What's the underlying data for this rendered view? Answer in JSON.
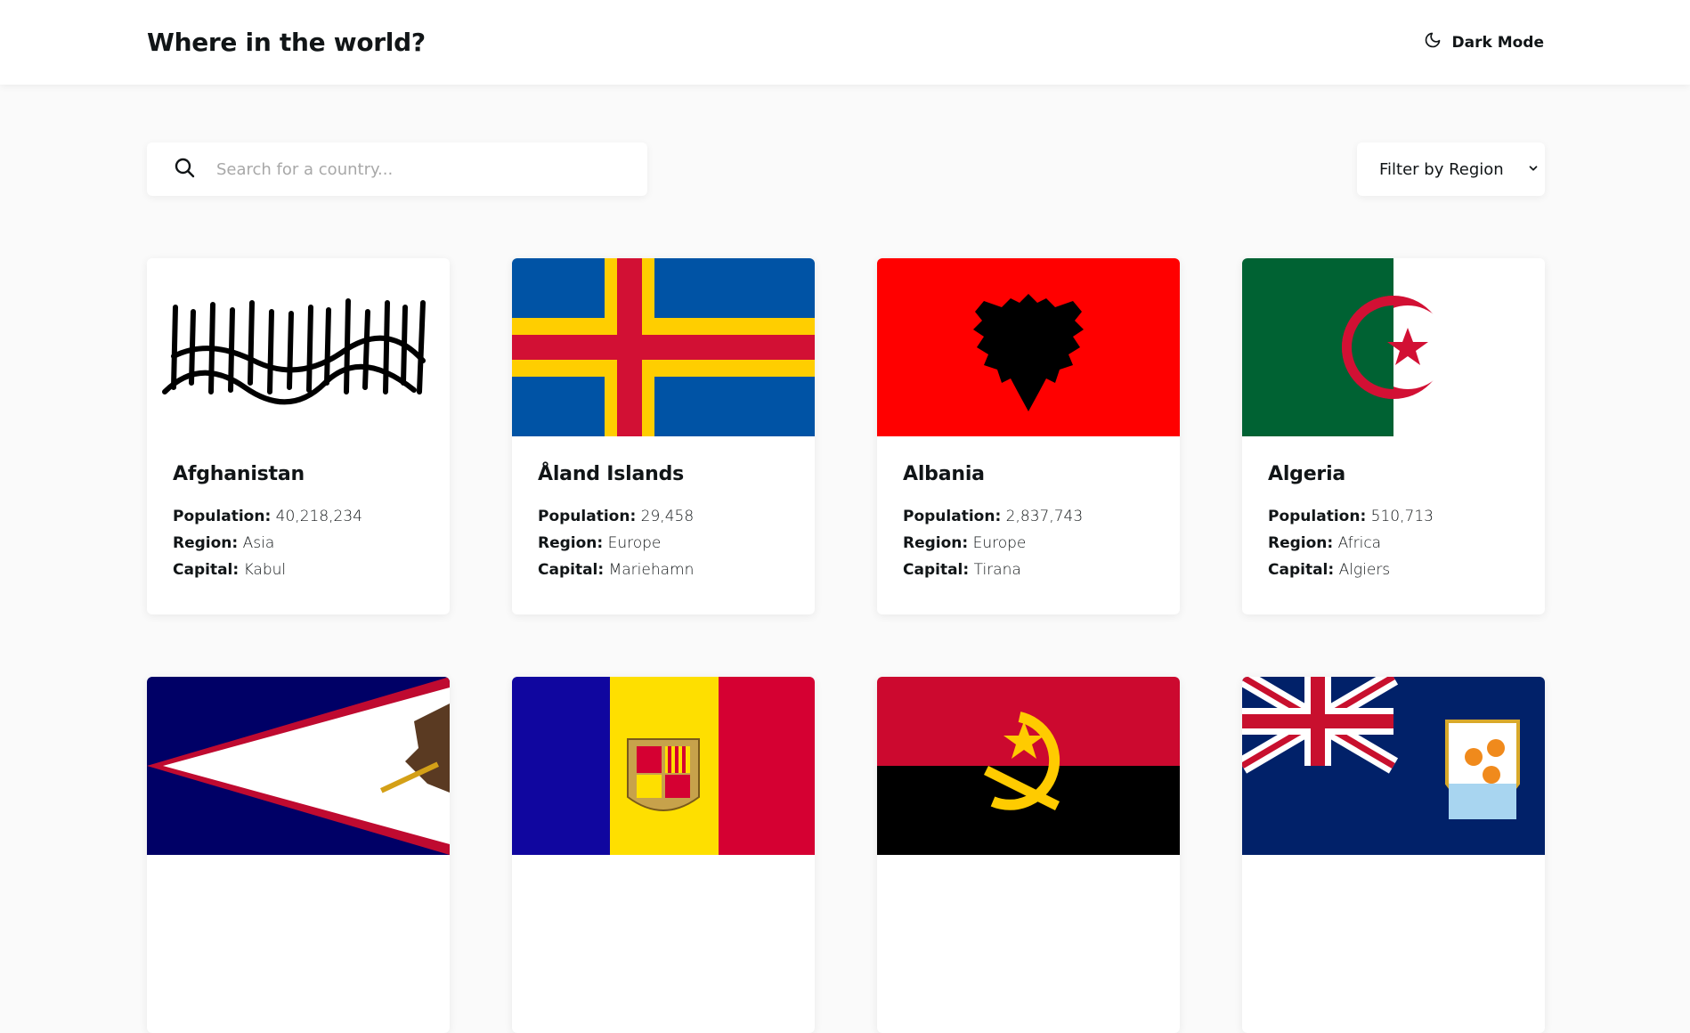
{
  "header": {
    "title": "Where in the world?",
    "mode_label": "Dark Mode"
  },
  "search": {
    "placeholder": "Search for a country..."
  },
  "filter": {
    "label": "Filter by Region"
  },
  "card_labels": {
    "population": "Population:",
    "region": "Region:",
    "capital": "Capital:"
  },
  "countries": [
    {
      "name": "Afghanistan",
      "population": "40,218,234",
      "region": "Asia",
      "capital": "Kabul"
    },
    {
      "name": "Åland Islands",
      "population": "29,458",
      "region": "Europe",
      "capital": "Mariehamn"
    },
    {
      "name": "Albania",
      "population": "2,837,743",
      "region": "Europe",
      "capital": "Tirana"
    },
    {
      "name": "Algeria",
      "population": "510,713",
      "region": "Africa",
      "capital": "Algiers"
    },
    {
      "name": "",
      "population": "",
      "region": "",
      "capital": ""
    },
    {
      "name": "",
      "population": "",
      "region": "",
      "capital": ""
    },
    {
      "name": "",
      "population": "",
      "region": "",
      "capital": ""
    },
    {
      "name": "",
      "population": "",
      "region": "",
      "capital": ""
    }
  ],
  "colors": {
    "background": "#fafafa",
    "element": "#ffffff",
    "text": "#111517",
    "placeholder": "#a8a8a8"
  }
}
